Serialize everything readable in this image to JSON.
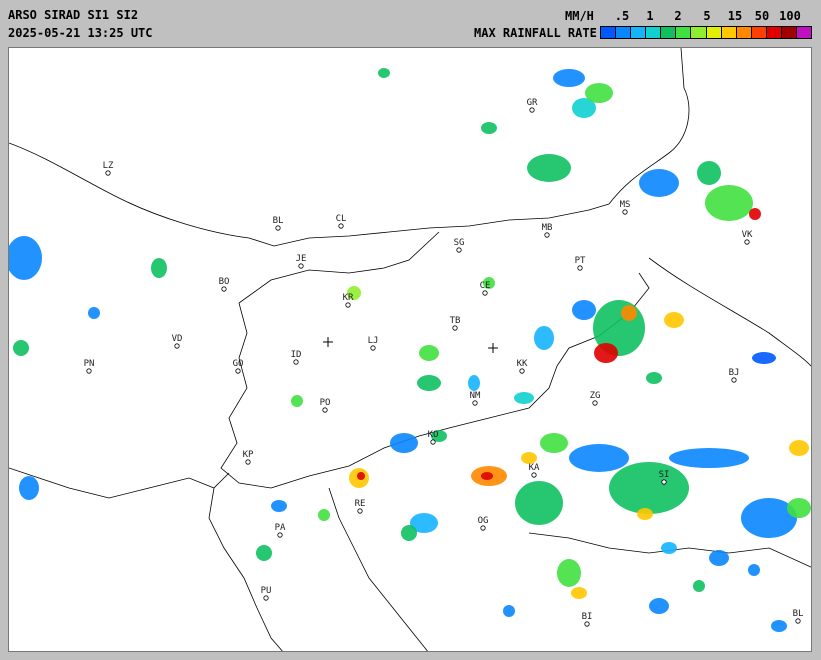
{
  "header": {
    "title": "ARSO SIRAD SI1 SI2",
    "timestamp": "2025-05-21 13:25 UTC",
    "unit": "MM/H",
    "legend_title": "MAX RAINFALL RATE"
  },
  "legend": {
    "ticks": [
      ".5",
      "1",
      "2",
      "5",
      "15",
      "50",
      "100"
    ],
    "colors": [
      "#0058ff",
      "#0a86ff",
      "#15b4ff",
      "#11d0d0",
      "#10c060",
      "#40e040",
      "#90ee30",
      "#e0f000",
      "#ffc800",
      "#ff8800",
      "#ff4000",
      "#e00000",
      "#a00000",
      "#c010c0"
    ]
  },
  "cities": [
    {
      "code": "LZ"
    },
    {
      "code": "BL"
    },
    {
      "code": "CL"
    },
    {
      "code": "GR"
    },
    {
      "code": "MB"
    },
    {
      "code": "MS"
    },
    {
      "code": "VK"
    },
    {
      "code": "SG"
    },
    {
      "code": "JE"
    },
    {
      "code": "BO"
    },
    {
      "code": "KR"
    },
    {
      "code": "CE"
    },
    {
      "code": "PT"
    },
    {
      "code": "TB"
    },
    {
      "code": "LJ"
    },
    {
      "code": "VD"
    },
    {
      "code": "PN"
    },
    {
      "code": "GO"
    },
    {
      "code": "ID"
    },
    {
      "code": "KK"
    },
    {
      "code": "BJ"
    },
    {
      "code": "PO"
    },
    {
      "code": "NM"
    },
    {
      "code": "ZG"
    },
    {
      "code": "KO"
    },
    {
      "code": "KP"
    },
    {
      "code": "KA"
    },
    {
      "code": "SI"
    },
    {
      "code": "RE"
    },
    {
      "code": "PA"
    },
    {
      "code": "OG"
    },
    {
      "code": "PU"
    },
    {
      "code": "BI"
    },
    {
      "code": "BL"
    }
  ]
}
